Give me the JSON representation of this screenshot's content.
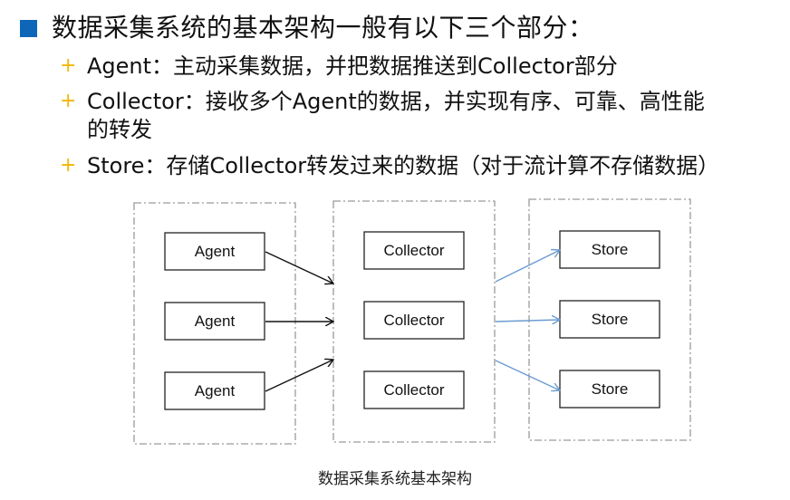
{
  "heading": "数据采集系统的基本架构一般有以下三个部分：",
  "bullets": [
    {
      "marker": "+",
      "text": "Agent：主动采集数据，并把数据推送到Collector部分"
    },
    {
      "marker": "+",
      "text": "Collector：接收多个Agent的数据，并实现有序、可靠、高性能",
      "continuation": "的转发"
    },
    {
      "marker": "+",
      "text": "Store：存储Collector转发过来的数据（对于流计算不存储数据）"
    }
  ],
  "diagram": {
    "agents": [
      "Agent",
      "Agent",
      "Agent"
    ],
    "collectors": [
      "Collector",
      "Collector",
      "Collector"
    ],
    "stores": [
      "Store",
      "Store",
      "Store"
    ],
    "colors": {
      "accent": "#0d66b8",
      "plus_marker": "#f2b705",
      "agent_arrow": "#111111",
      "store_arrow": "#6b9bd1",
      "group_border": "#9a9a9a"
    }
  },
  "caption": "数据采集系统基本架构"
}
